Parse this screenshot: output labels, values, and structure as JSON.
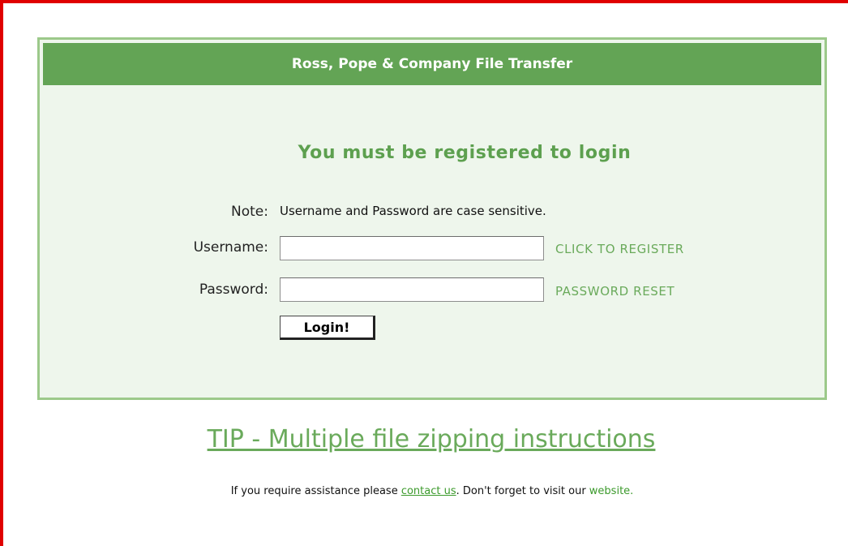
{
  "panel": {
    "header_title": "Ross, Pope & Company File Transfer",
    "headline": "You must be registered to login"
  },
  "form": {
    "note_label": "Note:",
    "note_text": "Username and Password are case sensitive.",
    "username_label": "Username:",
    "username_value": "",
    "password_label": "Password:",
    "password_value": "",
    "register_link": "CLICK TO REGISTER",
    "reset_link": "PASSWORD RESET",
    "login_button": "Login!"
  },
  "footer": {
    "tip_link": "TIP - Multiple file zipping instructions",
    "assist_prefix": "If you require assistance please ",
    "contact_link": "contact us",
    "assist_middle": ". Don't forget to visit our ",
    "website_link": "website."
  },
  "colors": {
    "page_border": "#e00000",
    "header_green": "#63a455",
    "panel_bg": "#eef6ec",
    "link_green": "#6aaa5b"
  }
}
